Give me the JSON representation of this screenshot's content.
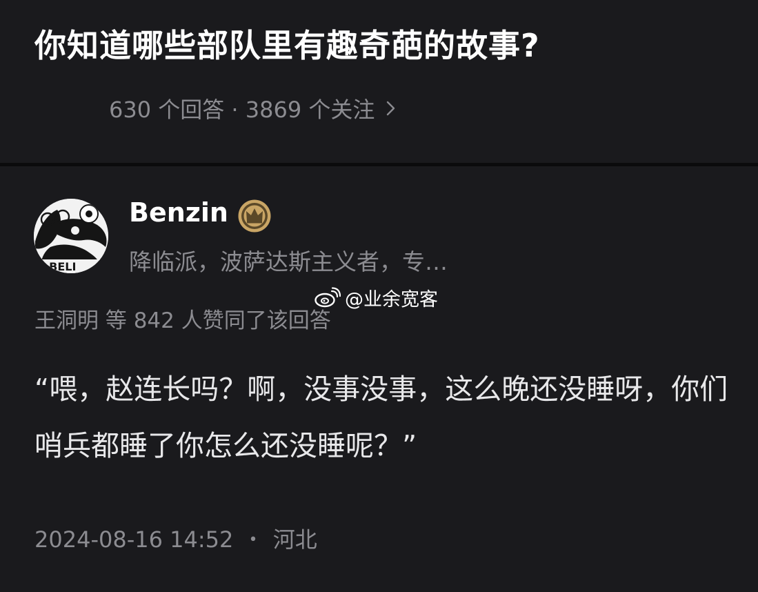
{
  "question": {
    "title": "你知道哪些部队里有趣奇葩的故事?",
    "stats": "630 个回答 · 3869 个关注"
  },
  "answer": {
    "author": {
      "name": "Benzin",
      "bio": "降临派，波萨达斯主义者，专…",
      "avatar_text": "O BELI"
    },
    "voters": "王洞明 等 842 人赞同了该回答",
    "content": "“喂，赵连长吗？啊，没事没事，这么晚还没睡呀，你们哨兵都睡了你怎么还没睡呢？”",
    "timestamp": "2024-08-16 14:52",
    "location": "河北",
    "meta_separator": "•"
  },
  "watermark": {
    "text": "@业余宽客"
  },
  "icons": {
    "stats_link": "chevron-right-icon",
    "badge": "crown-badge-icon",
    "watermark_logo": "weibo-logo-icon"
  },
  "colors": {
    "background": "#121214",
    "card": "#1a1a1d",
    "title": "#ffffff",
    "secondary_text": "#8c8c91",
    "body_text": "#e8e8ea",
    "badge_gold": "#c9a565"
  }
}
